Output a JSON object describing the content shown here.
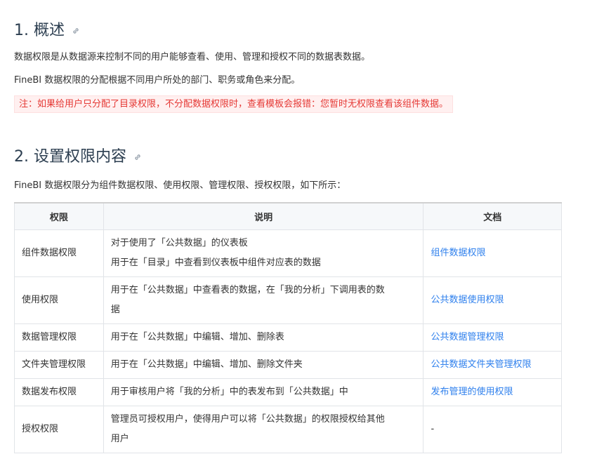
{
  "section1": {
    "title": "1. 概述",
    "para1": "数据权限是从数据源来控制不同的用户能够查看、使用、管理和授权不同的数据表数据。",
    "para2": "FineBI 数据权限的分配根据不同用户所处的部门、职务或角色来分配。",
    "note": "注：如果给用户只分配了目录权限，不分配数据权限时，查看模板会报错：您暂时无权限查看该组件数据。"
  },
  "section2": {
    "title": "2. 设置权限内容",
    "intro": "FineBI 数据权限分为组件数据权限、使用权限、管理权限、授权权限，如下所示："
  },
  "table": {
    "headers": [
      "权限",
      "说明",
      "文档"
    ],
    "rows": [
      {
        "permission": "组件数据权限",
        "desc_line1": "对于使用了「公共数据」的仪表板",
        "desc_line2": "用于在「目录」中查看到仪表板中组件对应表的数据",
        "doc": "组件数据权限"
      },
      {
        "permission": "使用权限",
        "desc_line1": "用于在「公共数据」中查看表的数据，在「我的分析」下调用表的数",
        "desc_line2": "据",
        "doc": "公共数据使用权限"
      },
      {
        "permission": "数据管理权限",
        "desc_line1": "用于在「公共数据」中编辑、增加、删除表",
        "doc": "公共数据管理权限"
      },
      {
        "permission": "文件夹管理权限",
        "desc_line1": "用于在「公共数据」中编辑、增加、删除文件夹",
        "doc": "公共数据文件夹管理权限"
      },
      {
        "permission": "数据发布权限",
        "desc_line1": "用于审核用户将「我的分析」中的表发布到「公共数据」中",
        "doc": "发布管理的使用权限"
      },
      {
        "permission": "授权权限",
        "desc_line1": "管理员可授权用户，使得用户可以将「公共数据」的权限授权给其他",
        "desc_line2": "用户",
        "doc": "-"
      }
    ]
  },
  "colors": {
    "heading": "#2c3e50",
    "note_text": "#e53935",
    "note_bg": "#fff0f0",
    "link": "#2f80ed"
  },
  "icons": {
    "anchor": "link-icon"
  }
}
